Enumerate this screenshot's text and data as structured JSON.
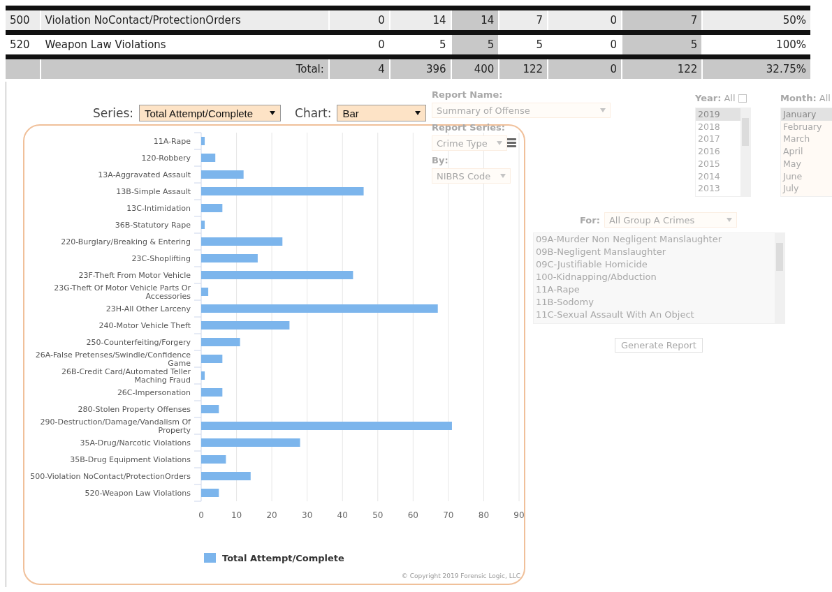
{
  "table": {
    "rows": [
      {
        "cells": [
          "500",
          "Violation NoContact/ProtectionOrders",
          "0",
          "14",
          "14",
          "7",
          "0",
          "7",
          "50%"
        ]
      },
      {
        "cells": [
          "520",
          "Weapon Law Violations",
          "0",
          "5",
          "5",
          "5",
          "0",
          "5",
          "100%"
        ]
      }
    ],
    "total": {
      "label": "Total:",
      "cells": [
        "4",
        "396",
        "400",
        "122",
        "0",
        "122",
        "32.75%"
      ]
    }
  },
  "controls": [
    {
      "label": "Series:",
      "value": "Total Attempt/Complete",
      "kind": "series"
    },
    {
      "label": "Chart:",
      "value": "Bar",
      "kind": "chart"
    }
  ],
  "chart": {
    "chart_data": {
      "type": "bar",
      "orientation": "horizontal",
      "categories": [
        "11A-Rape",
        "120-Robbery",
        "13A-Aggravated Assault",
        "13B-Simple Assault",
        "13C-Intimidation",
        "36B-Statutory Rape",
        "220-Burglary/Breaking & Entering",
        "23C-Shoplifting",
        "23F-Theft From Motor Vehicle",
        "23G-Theft Of Motor Vehicle Parts Or Accessories",
        "23H-All Other Larceny",
        "240-Motor Vehicle Theft",
        "250-Counterfeiting/Forgery",
        "26A-False Pretenses/Swindle/Confidence Game",
        "26B-Credit Card/Automated Teller Maching Fraud",
        "26C-Impersonation",
        "280-Stolen Property Offenses",
        "290-Destruction/Damage/Vandalism Of Property",
        "35A-Drug/Narcotic Violations",
        "35B-Drug Equipment Violations",
        "500-Violation NoContact/ProtectionOrders",
        "520-Weapon Law Violations"
      ],
      "series": [
        {
          "name": "Total Attempt/Complete",
          "color": "#7cb5ec",
          "values": [
            1,
            4,
            12,
            46,
            6,
            1,
            23,
            16,
            43,
            2,
            67,
            25,
            11,
            6,
            1,
            6,
            5,
            71,
            28,
            7,
            14,
            5
          ]
        }
      ],
      "grid": true,
      "xlim": [
        0,
        90
      ],
      "xticks": [
        0,
        10,
        20,
        30,
        40,
        50,
        60,
        70,
        80,
        90
      ]
    },
    "copyright": "© Copyright 2019 Forensic Logic, LLC"
  },
  "background_form": {
    "report_name": {
      "label": "Report Name:",
      "value": "Summary of Offense"
    },
    "report_series": {
      "label": "Report Series:",
      "value": "Crime Type"
    },
    "by": {
      "label": "By:",
      "value": "NIBRS Code"
    },
    "year": {
      "label": "Year:",
      "all": "All",
      "all_checked": false,
      "items": [
        {
          "text": "2019",
          "selected": true
        },
        {
          "text": "2018",
          "selected": false
        },
        {
          "text": "2017",
          "selected": false
        },
        {
          "text": "2016",
          "selected": false
        },
        {
          "text": "2015",
          "selected": false
        },
        {
          "text": "2014",
          "selected": false
        },
        {
          "text": "2013",
          "selected": false
        }
      ]
    },
    "month": {
      "label": "Month:",
      "all": "All",
      "items": [
        {
          "text": "January",
          "selected": true
        },
        {
          "text": "February",
          "selected": false
        },
        {
          "text": "March",
          "selected": false
        },
        {
          "text": "April",
          "selected": false
        },
        {
          "text": "May",
          "selected": false
        },
        {
          "text": "June",
          "selected": false
        },
        {
          "text": "July",
          "selected": false
        }
      ]
    },
    "for": {
      "label": "For:",
      "value": "All Group A Crimes"
    },
    "crimes": [
      {
        "text": "09A-Murder Non Negligent Manslaughter"
      },
      {
        "text": "09B-Negligent Manslaughter"
      },
      {
        "text": "09C-Justifiable Homicide"
      },
      {
        "text": "100-Kidnapping/Abduction"
      },
      {
        "text": "11A-Rape"
      },
      {
        "text": "11B-Sodomy"
      },
      {
        "text": "11C-Sexual Assault With An Object"
      }
    ],
    "generate_button": "Generate Report"
  }
}
